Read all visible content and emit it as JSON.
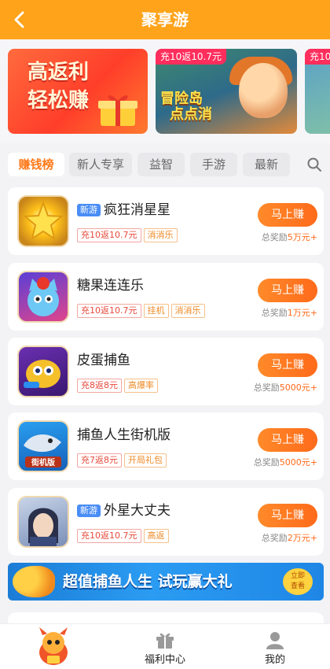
{
  "header": {
    "title": "聚享游"
  },
  "banners": [
    {
      "title_line1": "高返利",
      "title_line2": "轻松赚"
    },
    {
      "tag": "充10返10.7元",
      "title_line1": "冒险岛",
      "title_line2": "点点消"
    },
    {
      "tag": "充10"
    }
  ],
  "tabs": [
    {
      "label": "赚钱榜",
      "active": true
    },
    {
      "label": "新人专享"
    },
    {
      "label": "益智"
    },
    {
      "label": "手游"
    },
    {
      "label": "最新"
    }
  ],
  "games": [
    {
      "name": "疯狂消星星",
      "is_new": true,
      "new_label": "新游",
      "tags": [
        "充10返10.7元",
        "消消乐"
      ],
      "button": "马上赚",
      "reward_prefix": "总奖励",
      "reward_amount": "5万元+",
      "icon": "star-game-icon"
    },
    {
      "name": "糖果连连乐",
      "is_new": false,
      "tags": [
        "充10返10.7元",
        "挂机",
        "消消乐"
      ],
      "button": "马上赚",
      "reward_prefix": "总奖励",
      "reward_amount": "1万元+",
      "icon": "candy-cat-icon"
    },
    {
      "name": "皮蛋捕鱼",
      "is_new": false,
      "tags": [
        "充8返8元",
        "高爆率"
      ],
      "button": "马上赚",
      "reward_prefix": "总奖励",
      "reward_amount": "5000元+",
      "icon": "fishing-robot-icon"
    },
    {
      "name": "捕鱼人生街机版",
      "is_new": false,
      "tags": [
        "充7返8元",
        "开局礼包"
      ],
      "button": "马上赚",
      "reward_prefix": "总奖励",
      "reward_amount": "5000元+",
      "icon": "arcade-fish-icon",
      "icon_label": "街机版"
    },
    {
      "name": "外星大丈夫",
      "is_new": true,
      "new_label": "新游",
      "tags": [
        "充10返10.7元",
        "高返"
      ],
      "button": "马上赚",
      "reward_prefix": "总奖励",
      "reward_amount": "2万元+",
      "icon": "hero-portrait-icon"
    }
  ],
  "ad_banner": {
    "title": "超值捕鱼人生 试玩赢大礼",
    "cta_line1": "立即",
    "cta_line2": "查看"
  },
  "bottom_nav": [
    {
      "label": "",
      "icon": "mascot-icon"
    },
    {
      "label": "福利中心",
      "icon": "gift-icon"
    },
    {
      "label": "我的",
      "icon": "user-icon"
    }
  ],
  "colors": {
    "header": "#ffa31a",
    "accent": "#ff6a1a",
    "new_badge": "#4a8df6"
  }
}
